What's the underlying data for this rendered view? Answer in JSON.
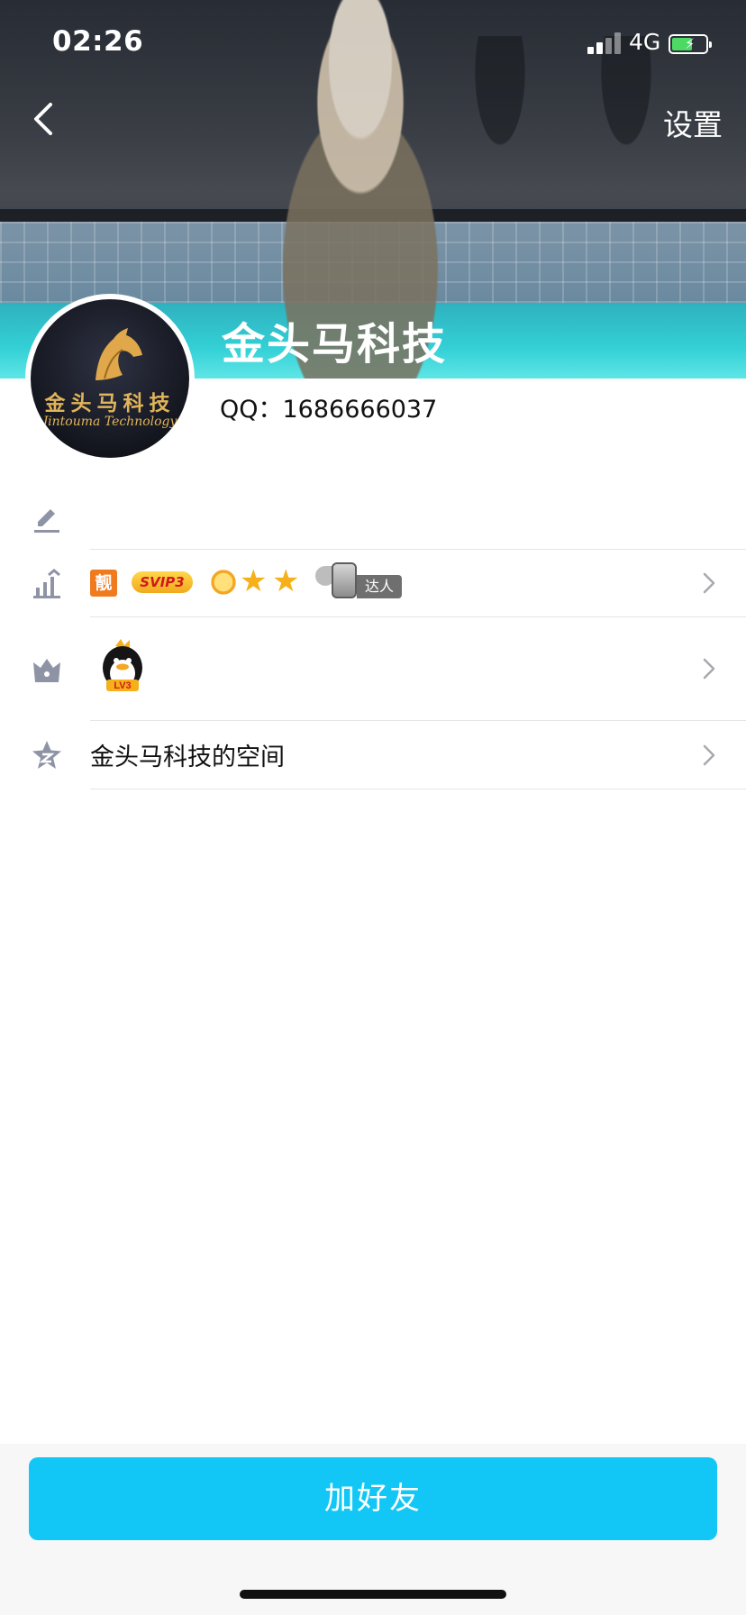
{
  "status_bar": {
    "time": "02:26",
    "network": "4G"
  },
  "header": {
    "settings_label": "设置"
  },
  "profile": {
    "nickname": "金头马科技",
    "qq_label": "QQ：1686666037",
    "avatar_logo_cn": "金头马科技",
    "avatar_logo_en": "Jintouma Technology"
  },
  "rows": {
    "badges": {
      "liang": "靓",
      "svip": "SVIP3",
      "daren": "达人"
    },
    "level": {
      "badge_text": "LV3"
    },
    "space": {
      "label": "金头马科技的空间"
    }
  },
  "footer": {
    "add_friend_label": "加好友"
  },
  "colors": {
    "primary_button": "#12c7f5",
    "icon_gray": "#8e94a6"
  },
  "icons": [
    "back-icon",
    "pencil-icon",
    "chart-icon",
    "crown-icon",
    "star-z-icon",
    "chevron-right-icon"
  ]
}
